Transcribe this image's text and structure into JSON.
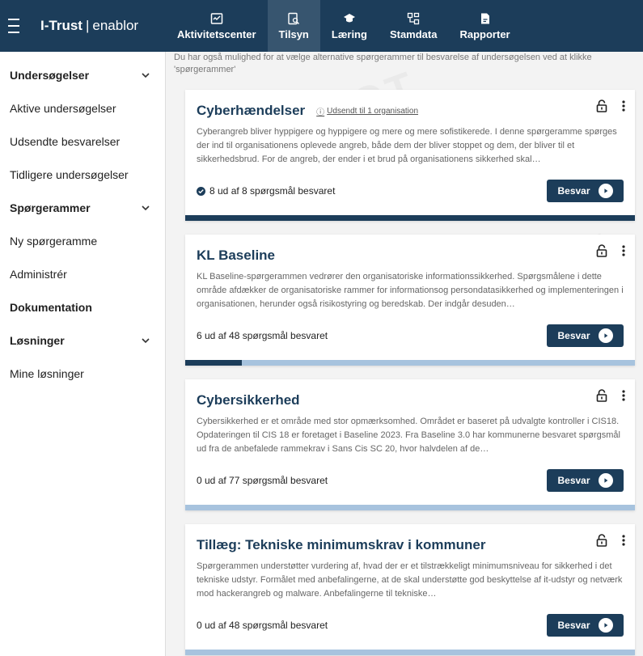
{
  "header": {
    "brand_name": "I-Trust",
    "brand_sep": "|",
    "brand_sub": "enablor",
    "tabs": [
      {
        "label": "Aktivitetscenter",
        "icon": "activity-icon"
      },
      {
        "label": "Tilsyn",
        "icon": "inspection-icon",
        "active": true
      },
      {
        "label": "Læring",
        "icon": "graduation-cap-icon"
      },
      {
        "label": "Stamdata",
        "icon": "hierarchy-icon"
      },
      {
        "label": "Rapporter",
        "icon": "report-icon"
      }
    ]
  },
  "sidebar": {
    "items": [
      {
        "label": "Undersøgelser",
        "head": true,
        "chevron": true
      },
      {
        "label": "Aktive undersøgelser"
      },
      {
        "label": "Udsendte besvarelser"
      },
      {
        "label": "Tidligere undersøgelser"
      },
      {
        "label": "Spørgerammer",
        "head": true,
        "chevron": true
      },
      {
        "label": "Ny spørgeramme"
      },
      {
        "label": "Administrér"
      },
      {
        "label": "Dokumentation",
        "head": true
      },
      {
        "label": "Løsninger",
        "head": true,
        "chevron": true
      },
      {
        "label": "Mine løsninger"
      }
    ]
  },
  "intro": "Du har også mulighed for at vælge alternative spørgerammer til besvarelse af undersøgelsen ved at klikke 'spørgerammer'",
  "cards": [
    {
      "title": "Cyberhændelser",
      "sent": "Udsendt til 1 organisation",
      "description": "Cyberangreb bliver hyppigere og hyppigere og mere og mere sofistikerede. I denne spørgeramme spørges der ind til organisationens oplevede angreb, både dem der bliver stoppet og dem, der bliver til et sikkerhedsbrud. For de angreb, der ender i et brud på organisationens sikkerhed skal…",
      "status": "8 ud af 8 spørgsmål besvaret",
      "done": true,
      "progress": 1.0,
      "button": "Besvar"
    },
    {
      "title": "KL Baseline",
      "sent": "",
      "description": "KL Baseline-spørgerammen vedrører den organisatoriske informationssikkerhed. Spørgsmålene i dette område afdækker de organisatoriske rammer for informationsog persondatasikkerhed og implementeringen i organisationen, herunder også risikostyring og beredskab. Der indgår desuden…",
      "status": "6 ud af 48 spørgsmål besvaret",
      "done": false,
      "progress": 0.125,
      "button": "Besvar"
    },
    {
      "title": "Cybersikkerhed",
      "sent": "",
      "description": "Cybersikkerhed er et område med stor opmærksomhed. Området er baseret på udvalgte kontroller i CIS18. Opdateringen til CIS 18 er foretaget i Baseline 2023. Fra Baseline 3.0 har kommunerne besvaret spørgsmål ud fra de anbefalede rammekrav i Sans Cis SC 20, hvor halvdelen af de…",
      "status": "0 ud af 77 spørgsmål besvaret",
      "done": false,
      "progress": 0.0,
      "button": "Besvar"
    },
    {
      "title": "Tillæg: Tekniske minimumskrav i kommuner",
      "sent": "",
      "description": "Spørgerammen understøtter vurdering af, hvad der er et tilstrækkeligt minimumsniveau for sikkerhed i det tekniske udstyr. Formålet med anbefalingerne, at de skal understøtte god beskyttelse af it-udstyr og netværk mod hackerangreb og malware. Anbefalingerne til tekniske…",
      "status": "0 ud af 48 spørgsmål besvaret",
      "done": false,
      "progress": 0.0,
      "button": "Besvar"
    }
  ],
  "colors": {
    "header": "#1c3d5a",
    "progress_track": "#a7c3de"
  }
}
